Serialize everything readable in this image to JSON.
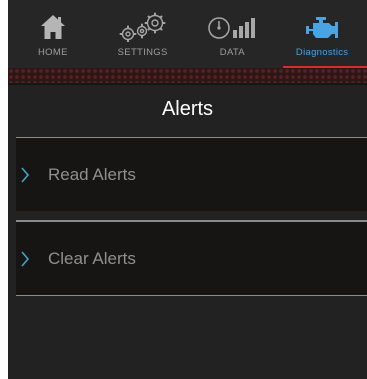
{
  "nav": {
    "tabs": [
      {
        "label": "HOME",
        "icon": "home-icon"
      },
      {
        "label": "SETTINGS",
        "icon": "gears-icon"
      },
      {
        "label": "DATA",
        "icon": "gauge-icon"
      },
      {
        "label": "Diagnostics",
        "icon": "engine-icon"
      }
    ],
    "active_index": 3
  },
  "page": {
    "title": "Alerts"
  },
  "items": [
    {
      "label": "Read Alerts",
      "icon": "chevron-right-icon"
    },
    {
      "label": "Clear Alerts",
      "icon": "chevron-right-icon"
    }
  ],
  "colors": {
    "accent": "#4aa3e2",
    "active_underline": "#d32f2f",
    "background": "#222222",
    "item_background": "#161513"
  }
}
